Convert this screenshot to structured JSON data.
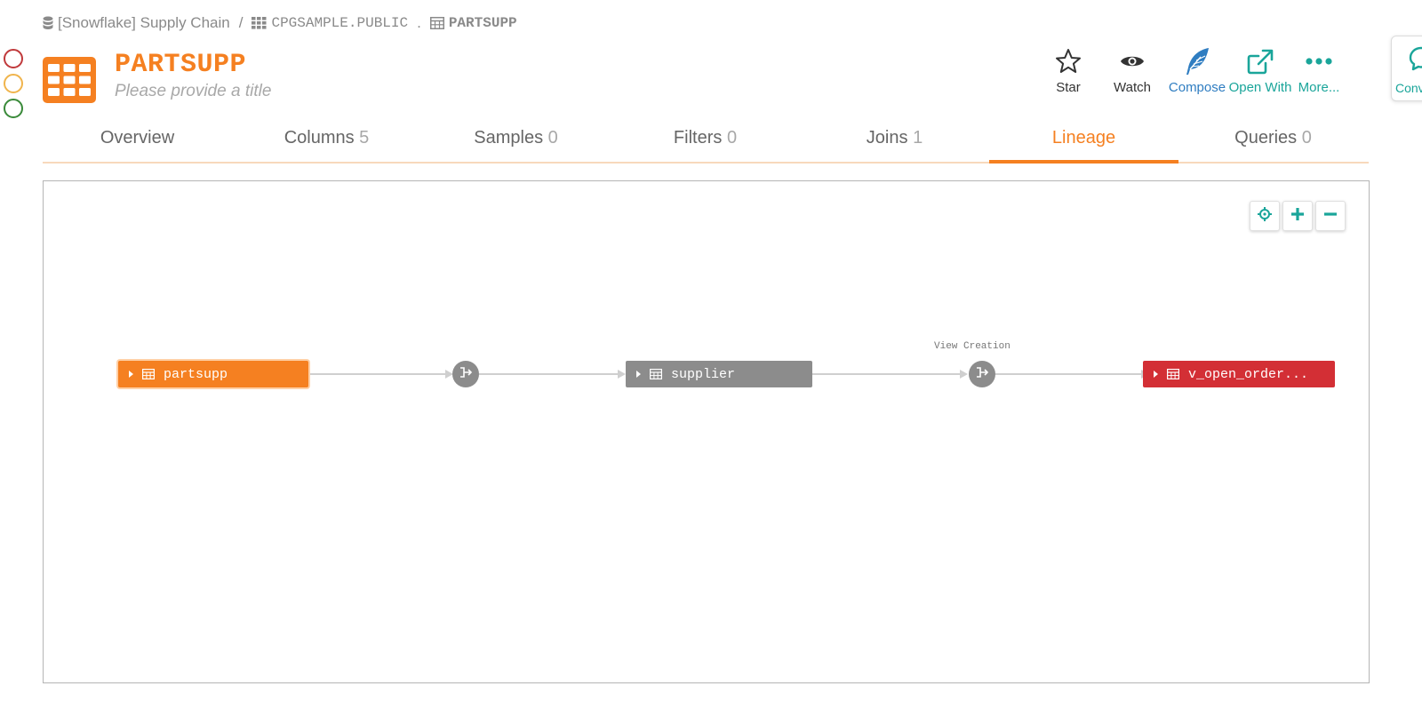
{
  "breadcrumb": {
    "datasource": "[Snowflake] Supply Chain",
    "separator": "/",
    "schema": "CPGSAMPLE.PUBLIC",
    "dot": ".",
    "table": "PARTSUPP"
  },
  "status_colors": [
    "#c0393b",
    "#f0b44c",
    "#3a8a3a"
  ],
  "header": {
    "title": "PARTSUPP",
    "subtitle": "Please provide a title",
    "accent_color": "#f58021"
  },
  "actions": [
    {
      "label": "Star",
      "icon": "star-icon"
    },
    {
      "label": "Watch",
      "icon": "eye-icon"
    },
    {
      "label": "Compose",
      "icon": "feather-icon"
    },
    {
      "label": "Open With",
      "icon": "external-link-icon"
    },
    {
      "label": "More...",
      "icon": "ellipsis-icon"
    }
  ],
  "side_panel": {
    "label": "Conv",
    "icon": "chat-icon"
  },
  "tabs": [
    {
      "label": "Overview",
      "count": ""
    },
    {
      "label": "Columns",
      "count": "5"
    },
    {
      "label": "Samples",
      "count": "0"
    },
    {
      "label": "Filters",
      "count": "0"
    },
    {
      "label": "Joins",
      "count": "1"
    },
    {
      "label": "Lineage",
      "count": ""
    },
    {
      "label": "Queries",
      "count": "0"
    }
  ],
  "active_tab": "Lineage",
  "lineage": {
    "controls": [
      "recenter-icon",
      "zoom-in-icon",
      "zoom-out-icon"
    ],
    "nodes": [
      {
        "label": "partsupp",
        "color": "#f58021"
      },
      {
        "label": "supplier",
        "color": "#8c8c8c"
      },
      {
        "label": "v_open_order...",
        "color": "#d32f35"
      }
    ],
    "processes": [
      {
        "label": ""
      },
      {
        "label": "View Creation"
      }
    ]
  }
}
